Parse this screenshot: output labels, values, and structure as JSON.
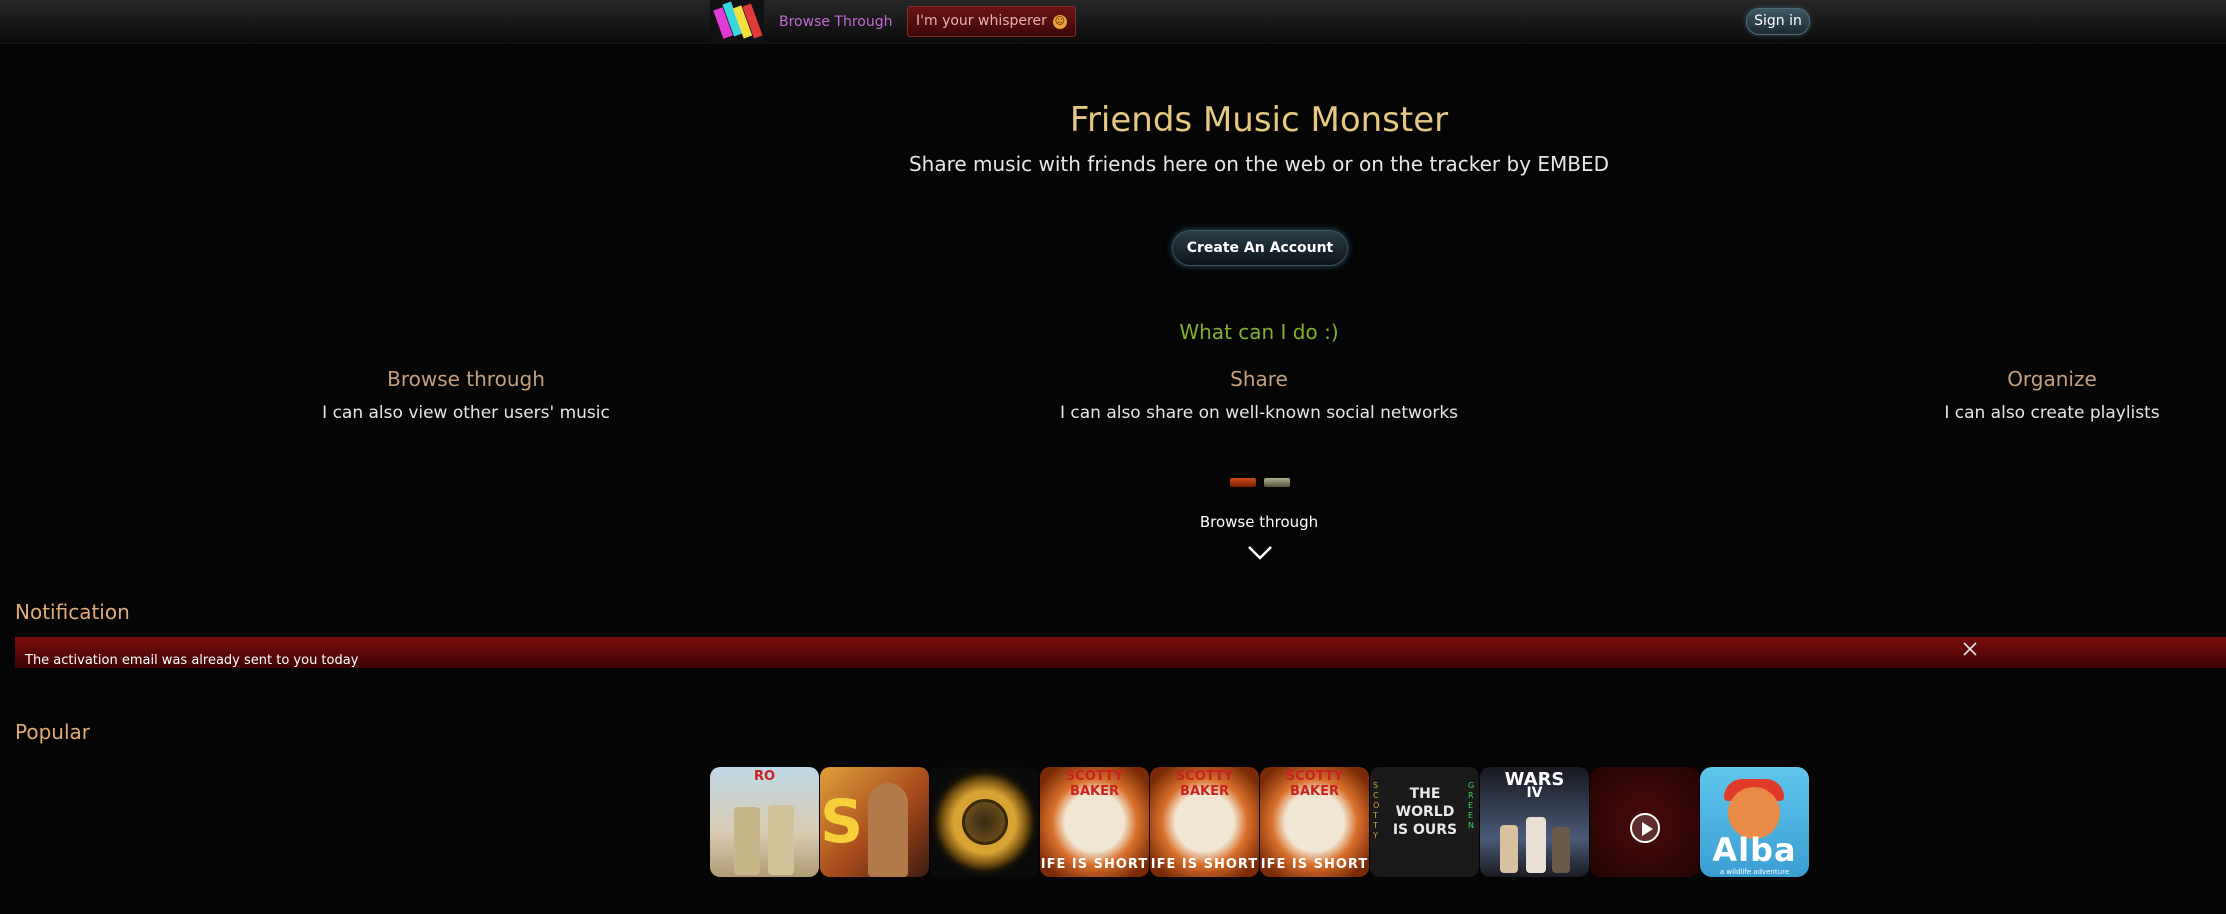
{
  "header": {
    "browse_label": "Browse Through",
    "whisper_label": "I'm your whisperer",
    "signin_label": "Sign in"
  },
  "hero": {
    "title": "Friends Music Monster",
    "subtitle": "Share music with friends here on the web or on the tracker by EMBED",
    "cta_label": "Create An Account"
  },
  "features": {
    "heading": "What can I do :)",
    "items": [
      {
        "title": "Browse through",
        "desc": "I can also view other users' music"
      },
      {
        "title": "Share",
        "desc": "I can also share on well-known social networks"
      },
      {
        "title": "Organize",
        "desc": "I can also create playlists"
      }
    ],
    "carousel_label": "Browse through"
  },
  "notification": {
    "title": "Notification",
    "message": "The activation email was already sent to you today"
  },
  "popular": {
    "title": "Popular",
    "covers": [
      {
        "text": "RO"
      },
      {
        "text": "S"
      },
      {
        "text": ""
      },
      {
        "top": "SCOTTY BAKER",
        "bottom": "IFE IS SHORT"
      },
      {
        "top": "SCOTTY BAKER",
        "bottom": "IFE IS SHORT"
      },
      {
        "top": "SCOTTY BAKER",
        "bottom": "IFE IS SHORT"
      },
      {
        "lines": [
          "THE",
          "WORLD",
          "IS OURS"
        ],
        "side_left": "SCOTTY",
        "side_right": "GREEN"
      },
      {
        "top": "WARS",
        "sub": "IV"
      },
      {
        "text": ""
      },
      {
        "bottom": "Alba",
        "sub": "a wildlife adventure"
      }
    ]
  },
  "colors": {
    "accent_red": "#7a0c0c",
    "title_gold": "#e5c882",
    "heading_green": "#7fb22a",
    "section_orange": "#e1aa77",
    "link_purple": "#c46ad6"
  }
}
